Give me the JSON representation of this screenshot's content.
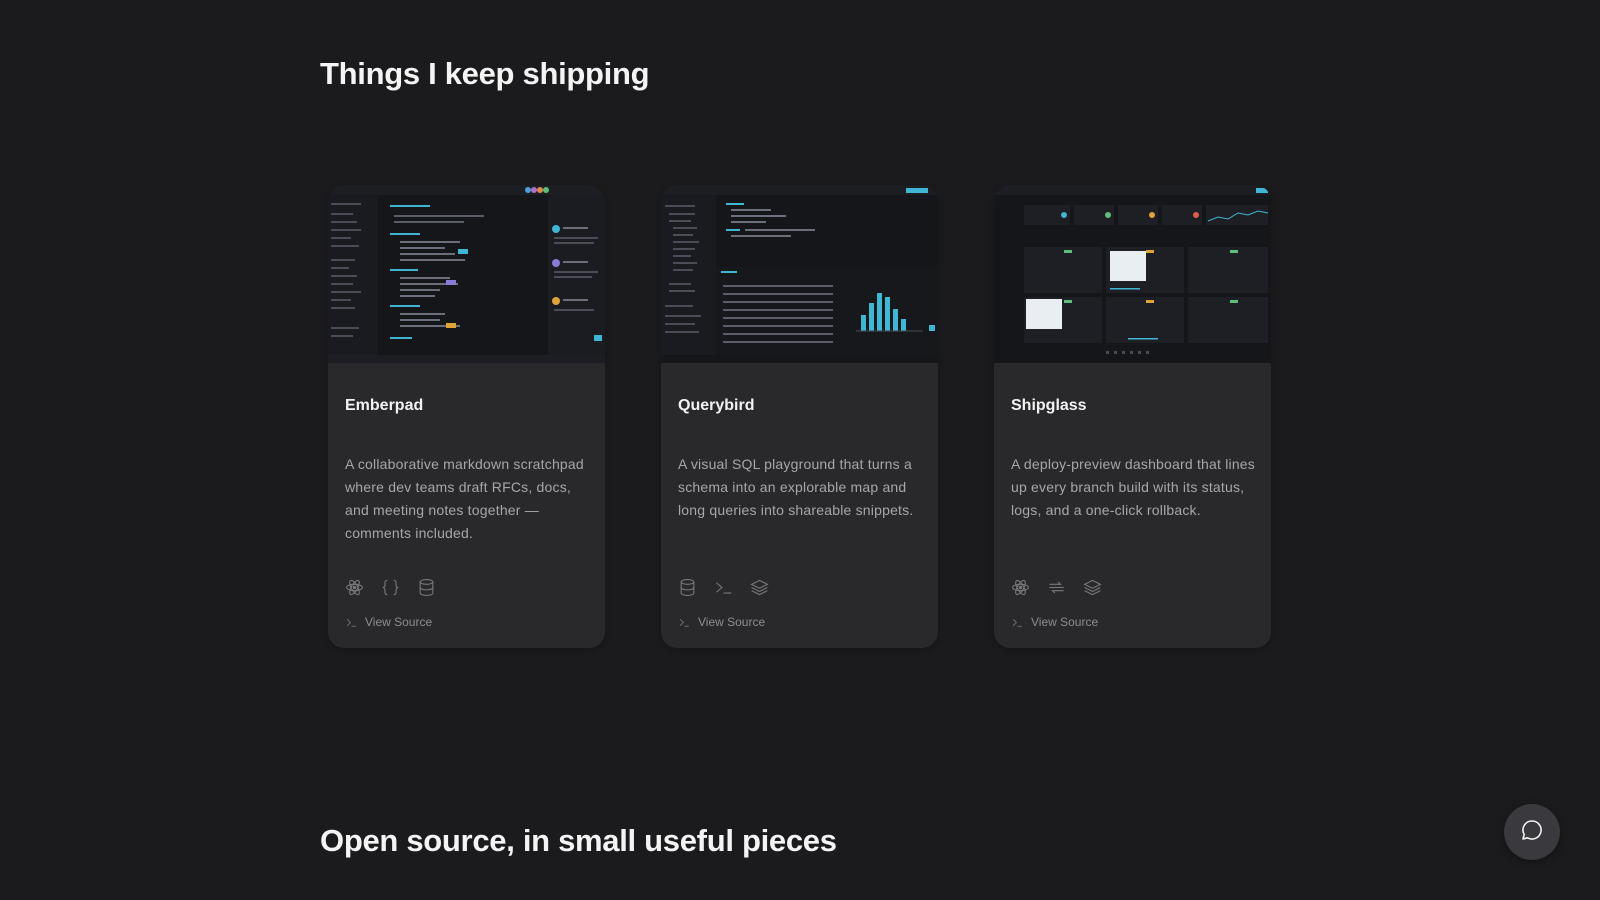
{
  "sections": {
    "projects_heading": "Things I keep shipping",
    "open_source_heading": "Open source, in small useful pieces"
  },
  "projects": [
    {
      "title": "Emberpad",
      "description": "A collaborative markdown scratchpad where dev teams draft RFCs, docs, and meeting notes together — comments included.",
      "tech_icons": [
        "react-icon",
        "braces-icon",
        "database-icon"
      ],
      "link_label": "View Source"
    },
    {
      "title": "Querybird",
      "description": "A visual SQL playground that turns a schema into an explorable map and long queries into shareable snippets.",
      "tech_icons": [
        "database-icon",
        "terminal-icon",
        "layers-icon"
      ],
      "link_label": "View Source"
    },
    {
      "title": "Shipglass",
      "description": "A deploy-preview dashboard that lines up every branch build with its status, logs, and a one-click rollback.",
      "tech_icons": [
        "react-icon",
        "arrows-icon",
        "layers-icon"
      ],
      "link_label": "View Source"
    }
  ],
  "colors": {
    "background": "#1b1b1d",
    "card": "#29292c",
    "accent": "#3fb6d3"
  },
  "chat_button": {
    "icon": "chat-bubble-icon"
  }
}
